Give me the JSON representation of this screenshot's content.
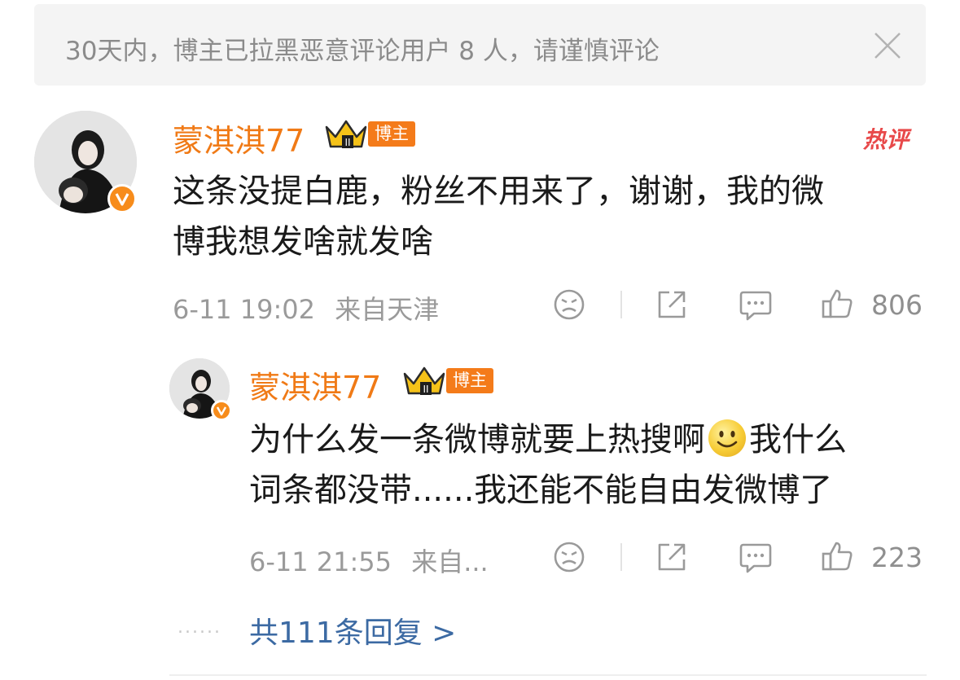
{
  "notice": {
    "text": "30天内，博主已拉黑恶意评论用户 8 人，请谨慎评论"
  },
  "comment": {
    "username": "蒙淇淇77",
    "role_tag": "博主",
    "hot_tag": "热评",
    "text_line1": "这条没提白鹿，粉丝不用来了，谢谢，我的微",
    "text_line2": "博我想发啥就发啥",
    "time": "6-11 19:02",
    "location": "来自天津",
    "likes": "806"
  },
  "reply": {
    "username": "蒙淇淇77",
    "role_tag": "博主",
    "text_line1_a": "为什么发一条微博就要上热搜啊",
    "text_line1_b": "我什么",
    "text_line2": "词条都没带......我还能不能自由发微博了",
    "time": "6-11 21:55",
    "location": "来自...",
    "likes": "223"
  },
  "more_replies": "共111条回复 >",
  "dots": "......",
  "colors": {
    "username": "#f07a16",
    "tag": "#f47b1a",
    "link": "#3c6aa3",
    "hot": "#e8494a"
  },
  "icons": [
    "close-icon",
    "dislike-icon",
    "share-icon",
    "comment-icon",
    "like-icon",
    "verified-icon",
    "crown-icon",
    "smile-emoji"
  ]
}
